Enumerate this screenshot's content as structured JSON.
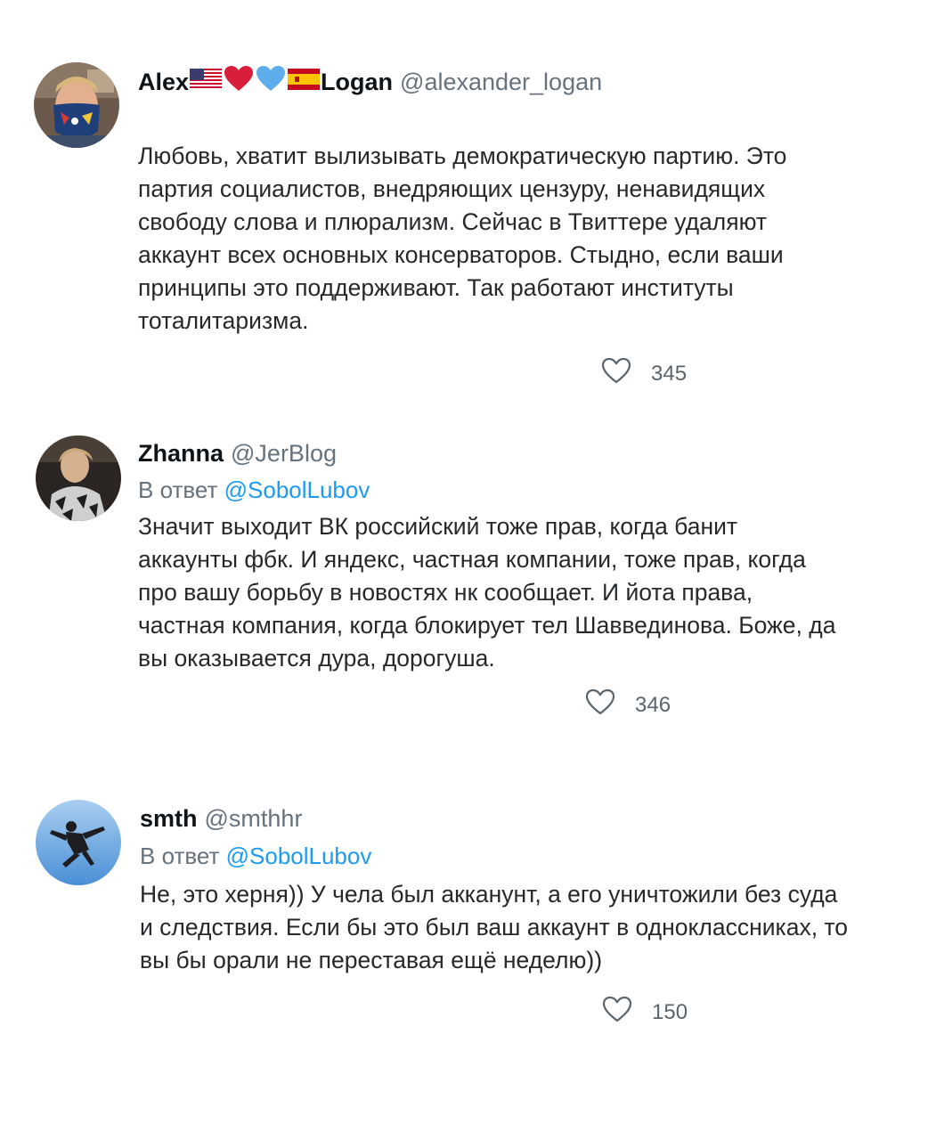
{
  "tweets": [
    {
      "display_name_prefix": "Alex",
      "display_name_suffix": "Logan",
      "name_emojis": [
        "us-flag",
        "red-heart",
        "blue-heart",
        "spain-flag"
      ],
      "handle": "@alexander_logan",
      "reply_prefix": "",
      "reply_to": "",
      "text_lines": [
        "Любовь, хватит вылизывать демократическую партию. Это",
        "партия социалистов, внедряющих цензуру, ненавидящих",
        "свободу слова и плюрализм. Сейчас в Твиттере удаляют",
        "аккаунт всех основных консерваторов. Стыдно, если ваши",
        "принципы это поддерживают. Так работают институты",
        "тоталитаризма."
      ],
      "likes": "345",
      "like_icon": "heart-outline-icon"
    },
    {
      "display_name_prefix": "Zhanna",
      "display_name_suffix": "",
      "name_emojis": [],
      "handle": "@JerBlog",
      "reply_prefix": "В ответ",
      "reply_to": "@SobolLubov",
      "text_lines": [
        "Значит выходит ВК российский тоже прав, когда банит",
        "аккаунты фбк. И яндекс, частная компании, тоже прав, когда",
        "про вашу борьбу в новостях нк сообщает. И йота права,",
        "частная компания, когда блокирует тел Шаввединова. Боже, да",
        "вы оказывается дура, дорогуша."
      ],
      "likes": "346",
      "like_icon": "heart-outline-icon"
    },
    {
      "display_name_prefix": "smth",
      "display_name_suffix": "",
      "name_emojis": [],
      "handle": "@smthhr",
      "reply_prefix": "В ответ",
      "reply_to": "@SobolLubov",
      "text_lines": [
        "Не, это херня)) У чела был акканунт, а его уничтожили без суда",
        "и следствия. Если бы это был ваш аккаунт в одноклассниках, то",
        "вы бы орали не переставая ещё неделю))"
      ],
      "likes": "150",
      "like_icon": "heart-outline-icon"
    }
  ],
  "colors": {
    "name": "#0f1419",
    "handle": "#66727d",
    "mention": "#1d9bf0",
    "body": "#26292c",
    "like_count": "#5a646d"
  }
}
